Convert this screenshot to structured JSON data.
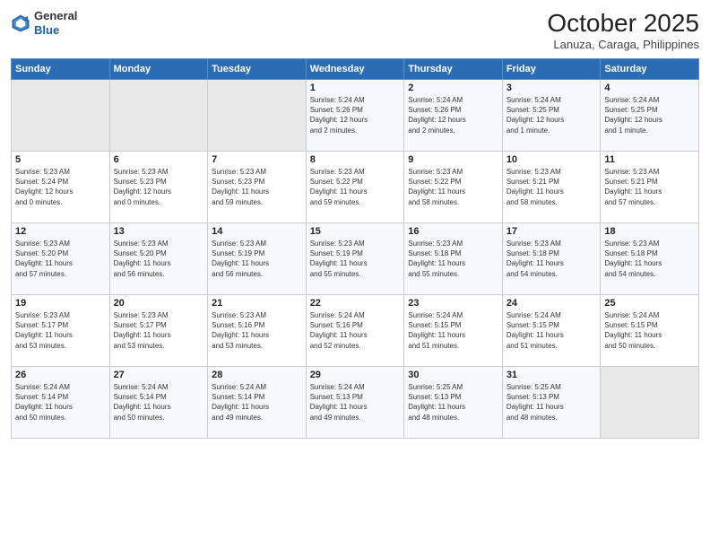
{
  "header": {
    "logo_general": "General",
    "logo_blue": "Blue",
    "month": "October 2025",
    "location": "Lanuza, Caraga, Philippines"
  },
  "weekdays": [
    "Sunday",
    "Monday",
    "Tuesday",
    "Wednesday",
    "Thursday",
    "Friday",
    "Saturday"
  ],
  "weeks": [
    [
      {
        "day": "",
        "info": ""
      },
      {
        "day": "",
        "info": ""
      },
      {
        "day": "",
        "info": ""
      },
      {
        "day": "1",
        "info": "Sunrise: 5:24 AM\nSunset: 5:26 PM\nDaylight: 12 hours\nand 2 minutes."
      },
      {
        "day": "2",
        "info": "Sunrise: 5:24 AM\nSunset: 5:26 PM\nDaylight: 12 hours\nand 2 minutes."
      },
      {
        "day": "3",
        "info": "Sunrise: 5:24 AM\nSunset: 5:25 PM\nDaylight: 12 hours\nand 1 minute."
      },
      {
        "day": "4",
        "info": "Sunrise: 5:24 AM\nSunset: 5:25 PM\nDaylight: 12 hours\nand 1 minute."
      }
    ],
    [
      {
        "day": "5",
        "info": "Sunrise: 5:23 AM\nSunset: 5:24 PM\nDaylight: 12 hours\nand 0 minutes."
      },
      {
        "day": "6",
        "info": "Sunrise: 5:23 AM\nSunset: 5:23 PM\nDaylight: 12 hours\nand 0 minutes."
      },
      {
        "day": "7",
        "info": "Sunrise: 5:23 AM\nSunset: 5:23 PM\nDaylight: 11 hours\nand 59 minutes."
      },
      {
        "day": "8",
        "info": "Sunrise: 5:23 AM\nSunset: 5:22 PM\nDaylight: 11 hours\nand 59 minutes."
      },
      {
        "day": "9",
        "info": "Sunrise: 5:23 AM\nSunset: 5:22 PM\nDaylight: 11 hours\nand 58 minutes."
      },
      {
        "day": "10",
        "info": "Sunrise: 5:23 AM\nSunset: 5:21 PM\nDaylight: 11 hours\nand 58 minutes."
      },
      {
        "day": "11",
        "info": "Sunrise: 5:23 AM\nSunset: 5:21 PM\nDaylight: 11 hours\nand 57 minutes."
      }
    ],
    [
      {
        "day": "12",
        "info": "Sunrise: 5:23 AM\nSunset: 5:20 PM\nDaylight: 11 hours\nand 57 minutes."
      },
      {
        "day": "13",
        "info": "Sunrise: 5:23 AM\nSunset: 5:20 PM\nDaylight: 11 hours\nand 56 minutes."
      },
      {
        "day": "14",
        "info": "Sunrise: 5:23 AM\nSunset: 5:19 PM\nDaylight: 11 hours\nand 56 minutes."
      },
      {
        "day": "15",
        "info": "Sunrise: 5:23 AM\nSunset: 5:19 PM\nDaylight: 11 hours\nand 55 minutes."
      },
      {
        "day": "16",
        "info": "Sunrise: 5:23 AM\nSunset: 5:18 PM\nDaylight: 11 hours\nand 55 minutes."
      },
      {
        "day": "17",
        "info": "Sunrise: 5:23 AM\nSunset: 5:18 PM\nDaylight: 11 hours\nand 54 minutes."
      },
      {
        "day": "18",
        "info": "Sunrise: 5:23 AM\nSunset: 5:18 PM\nDaylight: 11 hours\nand 54 minutes."
      }
    ],
    [
      {
        "day": "19",
        "info": "Sunrise: 5:23 AM\nSunset: 5:17 PM\nDaylight: 11 hours\nand 53 minutes."
      },
      {
        "day": "20",
        "info": "Sunrise: 5:23 AM\nSunset: 5:17 PM\nDaylight: 11 hours\nand 53 minutes."
      },
      {
        "day": "21",
        "info": "Sunrise: 5:23 AM\nSunset: 5:16 PM\nDaylight: 11 hours\nand 53 minutes."
      },
      {
        "day": "22",
        "info": "Sunrise: 5:24 AM\nSunset: 5:16 PM\nDaylight: 11 hours\nand 52 minutes."
      },
      {
        "day": "23",
        "info": "Sunrise: 5:24 AM\nSunset: 5:15 PM\nDaylight: 11 hours\nand 51 minutes."
      },
      {
        "day": "24",
        "info": "Sunrise: 5:24 AM\nSunset: 5:15 PM\nDaylight: 11 hours\nand 51 minutes."
      },
      {
        "day": "25",
        "info": "Sunrise: 5:24 AM\nSunset: 5:15 PM\nDaylight: 11 hours\nand 50 minutes."
      }
    ],
    [
      {
        "day": "26",
        "info": "Sunrise: 5:24 AM\nSunset: 5:14 PM\nDaylight: 11 hours\nand 50 minutes."
      },
      {
        "day": "27",
        "info": "Sunrise: 5:24 AM\nSunset: 5:14 PM\nDaylight: 11 hours\nand 50 minutes."
      },
      {
        "day": "28",
        "info": "Sunrise: 5:24 AM\nSunset: 5:14 PM\nDaylight: 11 hours\nand 49 minutes."
      },
      {
        "day": "29",
        "info": "Sunrise: 5:24 AM\nSunset: 5:13 PM\nDaylight: 11 hours\nand 49 minutes."
      },
      {
        "day": "30",
        "info": "Sunrise: 5:25 AM\nSunset: 5:13 PM\nDaylight: 11 hours\nand 48 minutes."
      },
      {
        "day": "31",
        "info": "Sunrise: 5:25 AM\nSunset: 5:13 PM\nDaylight: 11 hours\nand 48 minutes."
      },
      {
        "day": "",
        "info": ""
      }
    ]
  ]
}
